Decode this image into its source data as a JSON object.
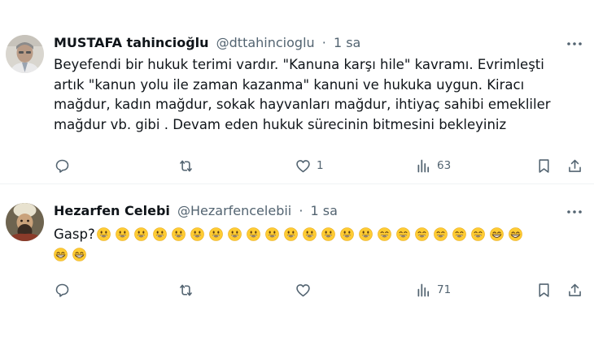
{
  "tweets": [
    {
      "display_name": "MUSTAFA tahincioğlu",
      "handle": "@dttahincioglu",
      "dot": "·",
      "time": "1 sa",
      "text_lines": [
        "Beyefendi bir hukuk terimi vardır. \"Kanuna karşı hile\" kavramı. Evrimleşti",
        "artık \"kanun yolu ile zaman kazanma\" kanuni ve hukuka uygun. Kiracı",
        "mağdur, kadın mağdur, sokak hayvanları mağdur, ihtiyaç sahibi emekliler",
        "mağdur vb. gibi . Devam eden hukuk sürecinin bitmesini bekleyiniz"
      ],
      "likes": "1",
      "views": "63",
      "avatar_icon": "man-portrait-avatar"
    },
    {
      "display_name": "Hezarfen Celebi",
      "handle": "@Hezarfencelebii",
      "dot": "·",
      "time": "1 sa",
      "text": "Gasp?",
      "emoji_first_line": [
        "grinning",
        "grinning",
        "grinning",
        "grinning",
        "grinning",
        "grinning",
        "grinning",
        "grinning",
        "grinning",
        "grinning",
        "grinning",
        "grinning",
        "grinning",
        "grinning",
        "grinning",
        "grin",
        "grin",
        "grin",
        "grin",
        "grin",
        "grin",
        "beaming",
        "beaming"
      ],
      "emoji_second_line": [
        "beaming",
        "beaming"
      ],
      "likes": "",
      "views": "71",
      "avatar_icon": "ottoman-portrait-avatar"
    }
  ],
  "action_icons": [
    "reply-icon",
    "retweet-icon",
    "like-icon",
    "views-icon",
    "bookmark-icon",
    "share-icon"
  ],
  "colors": {
    "text": "#0f1419",
    "muted": "#536471",
    "emoji": "#ffcc33",
    "separator": "#eff3f4"
  }
}
